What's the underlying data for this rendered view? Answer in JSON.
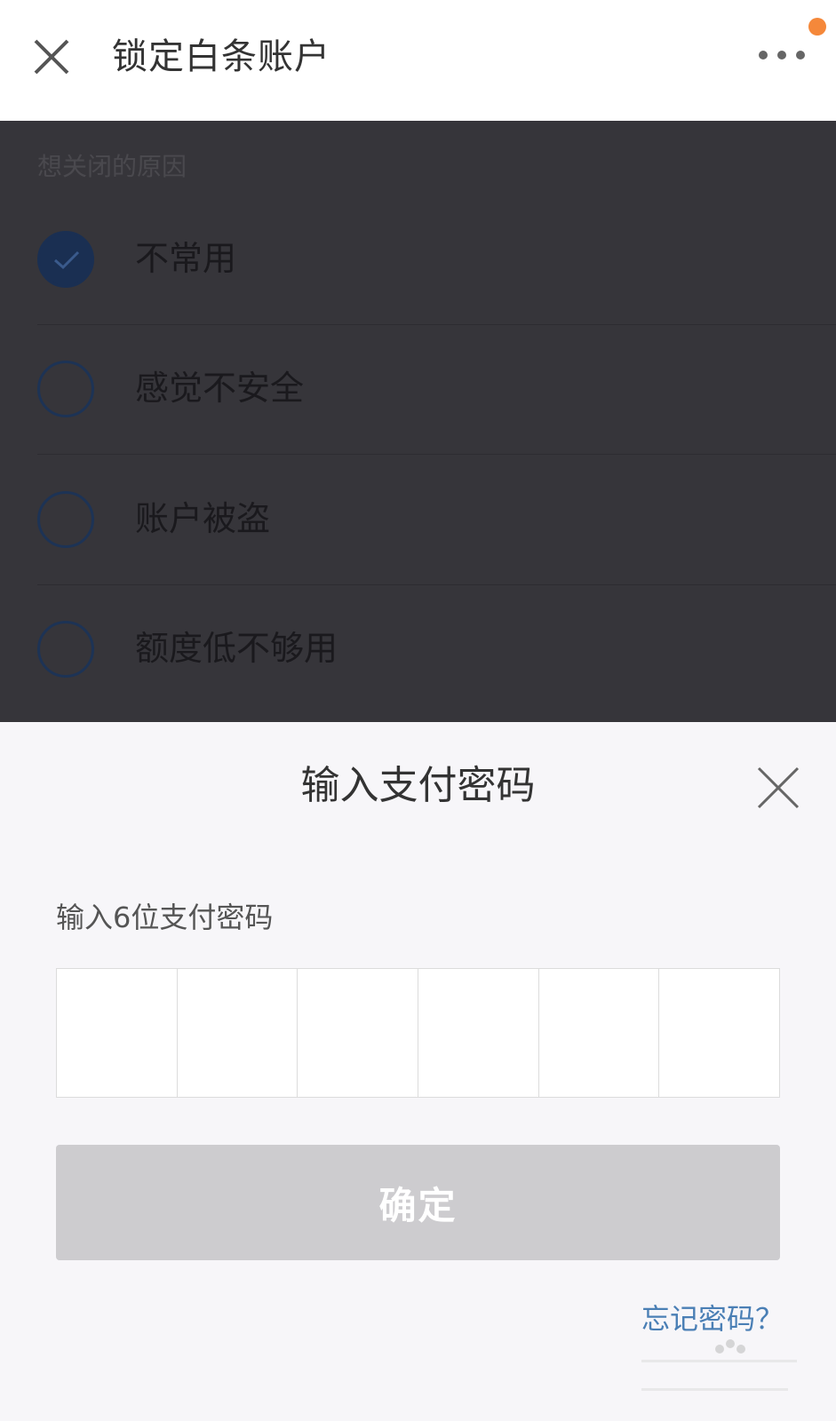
{
  "header": {
    "title": "锁定白条账户",
    "close_icon": "close-icon",
    "more_icon": "more-horizontal-icon",
    "notification_dot_color": "#f5883a"
  },
  "reasons": {
    "section_label": "想关闭的原因",
    "items": [
      {
        "label": "不常用",
        "selected": true
      },
      {
        "label": "感觉不安全",
        "selected": false
      },
      {
        "label": "账户被盗",
        "selected": false
      },
      {
        "label": "额度低不够用",
        "selected": false
      }
    ]
  },
  "password_sheet": {
    "title": "输入支付密码",
    "hint": "输入6位支付密码",
    "digit_count": 6,
    "confirm_label": "确定",
    "forgot_label": "忘记密码？",
    "close_icon": "close-icon"
  },
  "colors": {
    "accent_link": "#4a7fb5",
    "button_disabled": "#cdcccf",
    "overlay": "#36353a"
  }
}
